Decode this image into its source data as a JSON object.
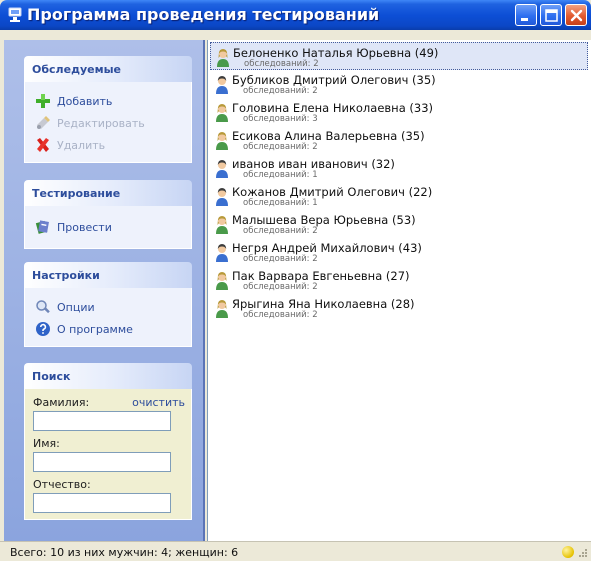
{
  "window": {
    "title": "Программа проведения тестирований",
    "icon": "app-icon",
    "controls": [
      "minimize-icon",
      "maximize-icon",
      "close-icon"
    ]
  },
  "sidebar": {
    "subjects": {
      "title": "Обследуемые",
      "items": [
        {
          "label": "Добавить",
          "icon": "add-icon",
          "enabled": true
        },
        {
          "label": "Редактировать",
          "icon": "edit-icon",
          "enabled": false
        },
        {
          "label": "Удалить",
          "icon": "delete-icon",
          "enabled": false
        }
      ]
    },
    "testing": {
      "title": "Тестирование",
      "items": [
        {
          "label": "Провести",
          "icon": "run-test-icon",
          "enabled": true
        }
      ]
    },
    "settings": {
      "title": "Настройки",
      "items": [
        {
          "label": "Опции",
          "icon": "options-icon",
          "enabled": true
        },
        {
          "label": "О программе",
          "icon": "help-icon",
          "enabled": true
        }
      ]
    },
    "search": {
      "title": "Поиск",
      "surname_label": "Фамилия:",
      "clear_label": "очистить",
      "name_label": "Имя:",
      "patronymic_label": "Отчество:",
      "surname_value": "",
      "name_value": "",
      "patronymic_value": ""
    }
  },
  "list": {
    "items": [
      {
        "name": "Белоненко Наталья Юрьевна (49)",
        "sub": "обследований: 2",
        "gender": "female",
        "selected": true
      },
      {
        "name": "Бубликов Дмитрий Олегович (35)",
        "sub": "обследований: 2",
        "gender": "male",
        "selected": false
      },
      {
        "name": "Головина Елена Николаевна (33)",
        "sub": "обследований: 3",
        "gender": "female",
        "selected": false
      },
      {
        "name": "Есикова Алина Валерьевна (35)",
        "sub": "обследований: 2",
        "gender": "female",
        "selected": false
      },
      {
        "name": "иванов иван иванович (32)",
        "sub": "обследований: 1",
        "gender": "male",
        "selected": false
      },
      {
        "name": "Кожанов Дмитрий Олегович (22)",
        "sub": "обследований: 1",
        "gender": "male",
        "selected": false
      },
      {
        "name": "Малышева Вера Юрьевна (53)",
        "sub": "обследований: 2",
        "gender": "female",
        "selected": false
      },
      {
        "name": "Негря  Андрей Михайлович (43)",
        "sub": "обследований: 2",
        "gender": "male",
        "selected": false
      },
      {
        "name": "Пак Варвара Евгеньевна (27)",
        "sub": "обследований: 2",
        "gender": "female",
        "selected": false
      },
      {
        "name": "Ярыгина Яна Николаевна (28)",
        "sub": "обследований: 2",
        "gender": "female",
        "selected": false
      }
    ]
  },
  "status": {
    "text": "Всего: 10 из них мужчин: 4; женщин: 6",
    "indicator_color": "#e6c200"
  },
  "colors": {
    "titlebar": "#0d4fd6",
    "accent": "#2d4d9c",
    "selection": "#dfe6f7"
  }
}
